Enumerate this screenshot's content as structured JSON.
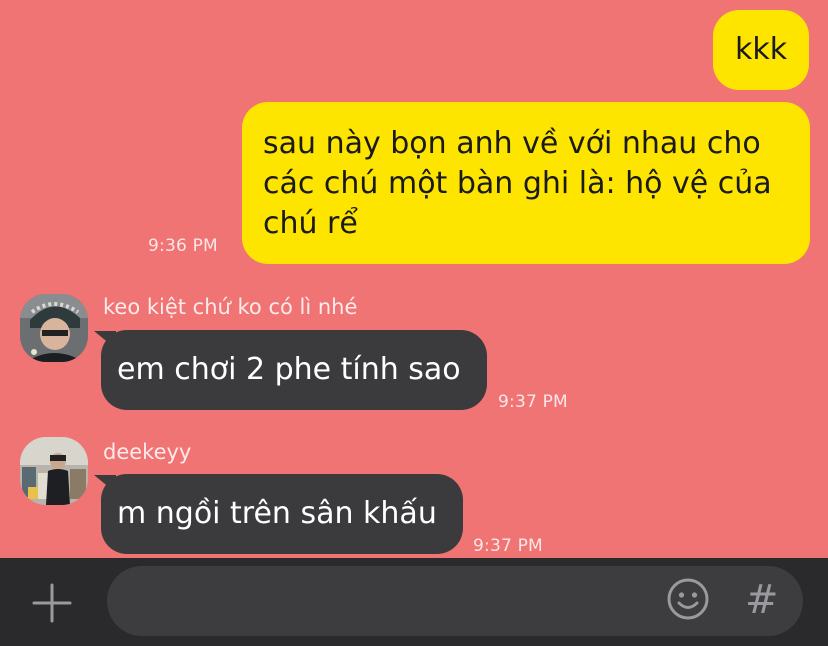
{
  "colors": {
    "background": "#f07474",
    "mine_bubble": "#fee500",
    "theirs_bubble": "#3b3b3d",
    "input_bar": "#2a2a2c"
  },
  "messages": [
    {
      "sender": "me",
      "lines": [
        "kkk"
      ]
    },
    {
      "sender": "me",
      "lines": [
        "sau này bọn anh về với nhau cho",
        "các chú một bàn ghi là: hộ vệ của",
        "chú rể"
      ],
      "time": "9:36 PM"
    },
    {
      "sender": "keo kiệt chứ ko có lì nhé",
      "lines": [
        "em chơi 2 phe tính sao"
      ],
      "time": "9:37 PM"
    },
    {
      "sender": "deekeyy",
      "lines": [
        "m ngồi trên sân khấu"
      ],
      "time": "9:37 PM"
    }
  ],
  "input_bar": {
    "plus_icon": "plus-icon",
    "emoji_icon": "emoji-icon",
    "hashtag_label": "#"
  }
}
